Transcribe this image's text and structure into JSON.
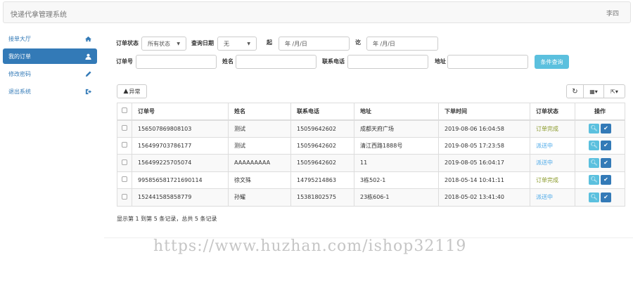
{
  "header": {
    "title": "快递代拿管理系统",
    "user": "李四"
  },
  "sidebar": {
    "items": [
      {
        "label": "接单大厅",
        "icon": "home-icon"
      },
      {
        "label": "我的订单",
        "icon": "user-icon",
        "active": true
      },
      {
        "label": "修改密码",
        "icon": "pencil-icon"
      },
      {
        "label": "退出系统",
        "icon": "logout-icon"
      }
    ]
  },
  "filters": {
    "status_label": "订单状态",
    "status_value": "所有状态",
    "date_label": "查询日期",
    "date_value": "无",
    "from_label": "起",
    "from_placeholder": "年 /月/日",
    "to_label": "讫",
    "to_placeholder": "年 /月/日",
    "order_label": "订单号",
    "name_label": "姓名",
    "phone_label": "联系电话",
    "addr_label": "地址",
    "search_button": "条件查询"
  },
  "toolbar": {
    "exception_button": "异常"
  },
  "table": {
    "headers": [
      "订单号",
      "姓名",
      "联系电话",
      "地址",
      "下单时间",
      "订单状态",
      "操作"
    ],
    "rows": [
      [
        "156507869808103",
        "测试",
        "15059642602",
        "成都天府广场",
        "2019-08-06 16:04:58",
        "订单完成"
      ],
      [
        "156499703786177",
        "测试",
        "15059642602",
        "清江西路1888号",
        "2019-08-05 17:23:58",
        "派送中"
      ],
      [
        "156499225705074",
        "AAAAAAAAA",
        "15059642602",
        "11",
        "2019-08-05 16:04:17",
        "派送中"
      ],
      [
        "995856581721690114",
        "徐文殊",
        "14795214863",
        "3栋502-1",
        "2018-05-14 10:41:11",
        "订单完成"
      ],
      [
        "152441585858779",
        "孙耀",
        "15381802575",
        "23栋606-1",
        "2018-05-02 13:41:40",
        "派送中"
      ]
    ]
  },
  "pagination": {
    "info": "显示第 1 到第 5 条记录，总共 5 条记录"
  },
  "watermark": "https://www.huzhan.com/ishop32119"
}
